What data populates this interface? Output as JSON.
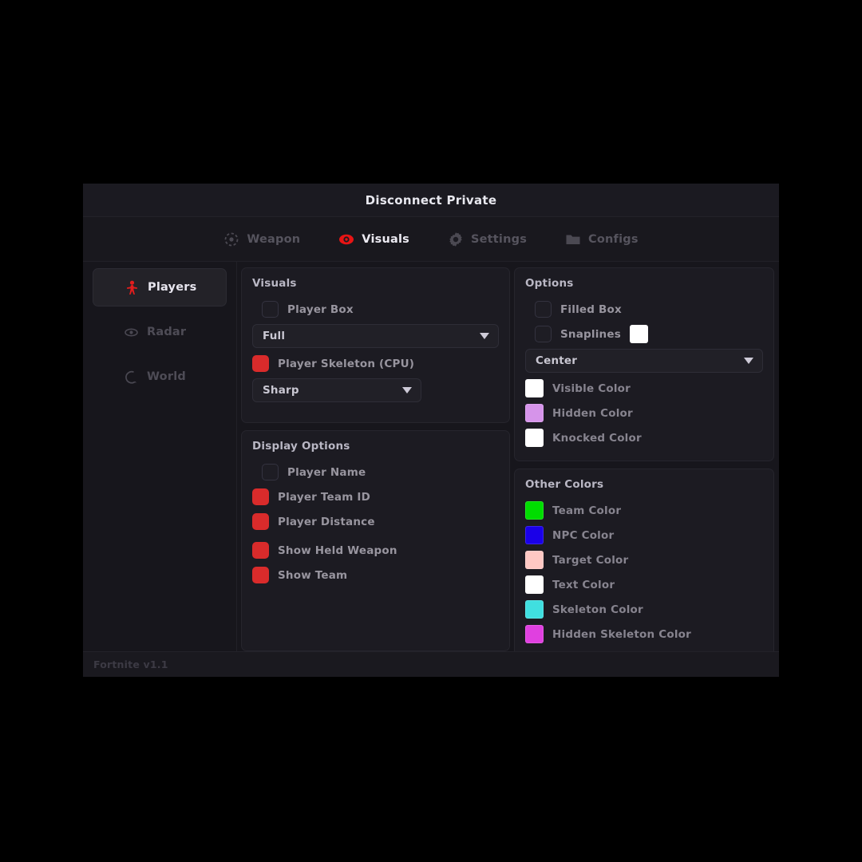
{
  "window": {
    "title": "Disconnect Private",
    "footer": "Fortnite v1.1"
  },
  "tabs": [
    {
      "label": "Weapon",
      "icon": "crosshair-icon",
      "active": false
    },
    {
      "label": "Visuals",
      "icon": "eye-icon",
      "active": true
    },
    {
      "label": "Settings",
      "icon": "gear-icon",
      "active": false
    },
    {
      "label": "Configs",
      "icon": "folder-icon",
      "active": false
    }
  ],
  "sidebar": {
    "items": [
      {
        "label": "Players",
        "icon": "person-icon",
        "active": true
      },
      {
        "label": "Radar",
        "icon": "eye-icon",
        "active": false
      },
      {
        "label": "World",
        "icon": "globe-icon",
        "active": false
      }
    ]
  },
  "panels": {
    "visuals": {
      "title": "Visuals",
      "player_box": {
        "label": "Player Box",
        "checked": false
      },
      "box_type": {
        "value": "Full"
      },
      "player_skeleton": {
        "label": "Player Skeleton (CPU)",
        "checked": true
      },
      "skeleton_type": {
        "value": "Sharp"
      }
    },
    "display_options": {
      "title": "Display Options",
      "items": [
        {
          "label": "Player Name",
          "checked": false
        },
        {
          "label": "Player Team ID",
          "checked": true
        },
        {
          "label": "Player Distance",
          "checked": true
        },
        {
          "label": "Show Held Weapon",
          "checked": true
        },
        {
          "label": "Show Team",
          "checked": true
        }
      ]
    },
    "options": {
      "title": "Options",
      "filled_box": {
        "label": "Filled Box",
        "checked": false
      },
      "snaplines": {
        "label": "Snaplines",
        "checked": false,
        "color": "#ffffff"
      },
      "snapline_origin": {
        "value": "Center"
      },
      "colors": [
        {
          "label": "Visible Color",
          "color": "#ffffff"
        },
        {
          "label": "Hidden Color",
          "color": "#d694ea"
        },
        {
          "label": "Knocked Color",
          "color": "#ffffff"
        }
      ]
    },
    "other_colors": {
      "title": "Other Colors",
      "items": [
        {
          "label": "Team Color",
          "color": "#00dd00"
        },
        {
          "label": "NPC Color",
          "color": "#1a00e8"
        },
        {
          "label": "Target Color",
          "color": "#ffc8c4"
        },
        {
          "label": "Text Color",
          "color": "#ffffff"
        },
        {
          "label": "Skeleton Color",
          "color": "#40dfe0"
        },
        {
          "label": "Hidden Skeleton Color",
          "color": "#e040e0"
        }
      ]
    }
  },
  "theme": {
    "accent": "#d92b2b",
    "window_bg": "#17161c",
    "panel_bg": "#1c1b22"
  }
}
